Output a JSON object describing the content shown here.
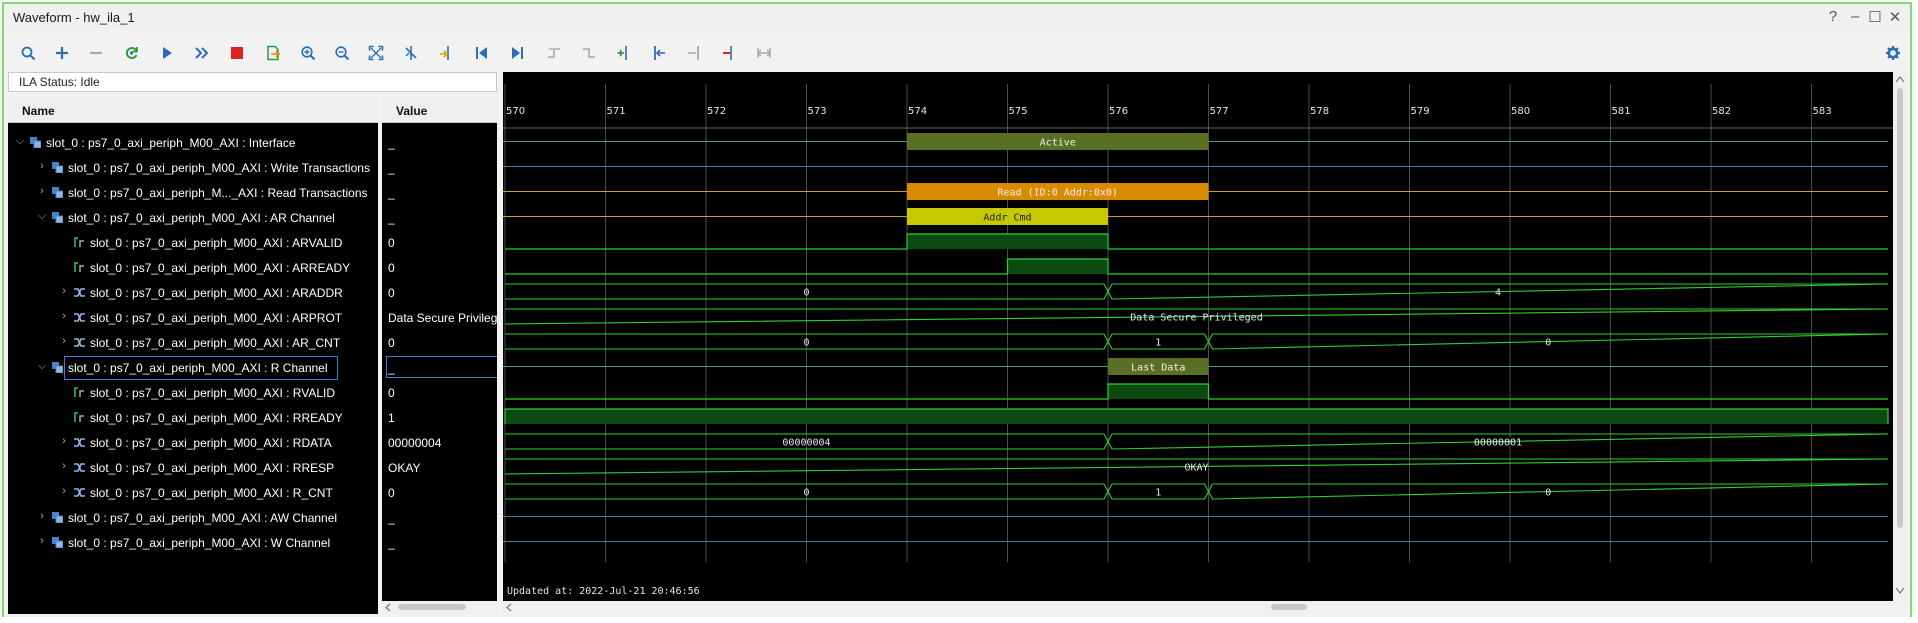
{
  "window": {
    "title": "Waveform - hw_ila_1",
    "help_label": "?",
    "minimize_label": "–",
    "maximize_label": "☐",
    "close_label": "✕"
  },
  "status": {
    "text": "ILA Status:  Idle"
  },
  "columns": {
    "name": "Name",
    "value": "Value"
  },
  "rows": [
    {
      "name": "slot_0 : ps7_0_axi_periph_M00_AXI : Interface",
      "value": "_",
      "level": 0,
      "expander": "open",
      "icon": "interface"
    },
    {
      "name": "slot_0 : ps7_0_axi_periph_M00_AXI : Write Transactions",
      "value": "_",
      "level": 1,
      "expander": "closed",
      "icon": "interface"
    },
    {
      "name": "slot_0 : ps7_0_axi_periph_M..._AXI : Read Transactions",
      "value": "_",
      "level": 1,
      "expander": "closed",
      "icon": "interface"
    },
    {
      "name": "slot_0 : ps7_0_axi_periph_M00_AXI : AR Channel",
      "value": "_",
      "level": 1,
      "expander": "open",
      "icon": "interface"
    },
    {
      "name": "slot_0 : ps7_0_axi_periph_M00_AXI : ARVALID",
      "value": "0",
      "level": 2,
      "expander": "none",
      "icon": "bit"
    },
    {
      "name": "slot_0 : ps7_0_axi_periph_M00_AXI : ARREADY",
      "value": "0",
      "level": 2,
      "expander": "none",
      "icon": "bit"
    },
    {
      "name": "slot_0 : ps7_0_axi_periph_M00_AXI : ARADDR",
      "value": "0",
      "level": 2,
      "expander": "closed",
      "icon": "bus"
    },
    {
      "name": "slot_0 : ps7_0_axi_periph_M00_AXI : ARPROT",
      "value": "Data Secure Privileged",
      "level": 2,
      "expander": "closed",
      "icon": "bus"
    },
    {
      "name": "slot_0 : ps7_0_axi_periph_M00_AXI : AR_CNT",
      "value": "0",
      "level": 2,
      "expander": "closed",
      "icon": "bus"
    },
    {
      "name": "slot_0 : ps7_0_axi_periph_M00_AXI : R Channel",
      "value": "_",
      "level": 1,
      "expander": "open",
      "icon": "interface",
      "selected": true
    },
    {
      "name": "slot_0 : ps7_0_axi_periph_M00_AXI : RVALID",
      "value": "0",
      "level": 2,
      "expander": "none",
      "icon": "bit"
    },
    {
      "name": "slot_0 : ps7_0_axi_periph_M00_AXI : RREADY",
      "value": "1",
      "level": 2,
      "expander": "none",
      "icon": "bit"
    },
    {
      "name": "slot_0 : ps7_0_axi_periph_M00_AXI : RDATA",
      "value": "00000004",
      "level": 2,
      "expander": "closed",
      "icon": "bus"
    },
    {
      "name": "slot_0 : ps7_0_axi_periph_M00_AXI : RRESP",
      "value": "OKAY",
      "level": 2,
      "expander": "closed",
      "icon": "bus"
    },
    {
      "name": "slot_0 : ps7_0_axi_periph_M00_AXI : R_CNT",
      "value": "0",
      "level": 2,
      "expander": "closed",
      "icon": "bus"
    },
    {
      "name": "slot_0 : ps7_0_axi_periph_M00_AXI : AW Channel",
      "value": "_",
      "level": 1,
      "expander": "closed",
      "icon": "interface"
    },
    {
      "name": "slot_0 : ps7_0_axi_periph_M00_AXI : W Channel",
      "value": "_",
      "level": 1,
      "expander": "closed",
      "icon": "interface"
    }
  ],
  "toolbar": [
    {
      "id": "zoom-search",
      "icon": "search-icon"
    },
    {
      "id": "add",
      "icon": "plus-icon"
    },
    {
      "id": "remove",
      "icon": "minus-icon"
    },
    {
      "id": "refresh",
      "icon": "refresh-icon"
    },
    {
      "id": "run-trigger",
      "icon": "play-icon"
    },
    {
      "id": "run-immediate",
      "icon": "double-chevron-icon"
    },
    {
      "id": "stop",
      "icon": "stop-icon"
    },
    {
      "id": "export",
      "icon": "export-icon"
    },
    {
      "id": "zoom-in",
      "icon": "zoom-in-icon"
    },
    {
      "id": "zoom-out",
      "icon": "zoom-out-icon"
    },
    {
      "id": "zoom-fit",
      "icon": "zoom-fit-icon"
    },
    {
      "id": "cursor-off",
      "icon": "cursor-off-icon"
    },
    {
      "id": "marker",
      "icon": "marker-icon"
    },
    {
      "id": "go-first",
      "icon": "go-first-icon"
    },
    {
      "id": "go-last",
      "icon": "go-last-icon"
    },
    {
      "id": "prev-transition",
      "icon": "prev-transition-icon"
    },
    {
      "id": "next-transition",
      "icon": "next-transition-icon"
    },
    {
      "id": "add-marker",
      "icon": "add-marker-icon"
    },
    {
      "id": "prev-marker",
      "icon": "prev-marker-icon"
    },
    {
      "id": "next-marker",
      "icon": "next-marker-icon"
    },
    {
      "id": "swap-cursor",
      "icon": "swap-cursor-icon"
    },
    {
      "id": "floating-ruler",
      "icon": "floating-ruler-icon"
    }
  ],
  "timeline": {
    "start": 570,
    "end": 583,
    "tick_labels": [
      "570",
      "571",
      "572",
      "573",
      "574",
      "575",
      "576",
      "577",
      "578",
      "579",
      "580",
      "581",
      "582",
      "583"
    ]
  },
  "waves": [
    {
      "type": "txn",
      "color": "#5a6e24",
      "blocks": [
        {
          "from": 574,
          "to": 577,
          "label": "Active"
        }
      ]
    },
    {
      "type": "idle"
    },
    {
      "type": "txn",
      "color": "#d98b00",
      "blocks": [
        {
          "from": 574,
          "to": 577,
          "label": "Read (ID:0 Addr:0x0)"
        }
      ]
    },
    {
      "type": "txn",
      "color": "#c8c800",
      "blocks": [
        {
          "from": 574,
          "to": 576,
          "label": "Addr Cmd"
        }
      ]
    },
    {
      "type": "bit",
      "highs": [
        [
          574,
          576
        ]
      ]
    },
    {
      "type": "bit",
      "highs": [
        [
          575,
          576
        ]
      ]
    },
    {
      "type": "bus",
      "segments": [
        {
          "from": 570,
          "to": 576,
          "label": "0"
        },
        {
          "from": 576,
          "to": 584,
          "label": "4"
        }
      ]
    },
    {
      "type": "bus",
      "segments": [
        {
          "from": 570,
          "to": 584,
          "label": "Data Secure Privileged"
        }
      ]
    },
    {
      "type": "bus",
      "segments": [
        {
          "from": 570,
          "to": 576,
          "label": "0"
        },
        {
          "from": 576,
          "to": 577,
          "label": "1"
        },
        {
          "from": 577,
          "to": 584,
          "label": "0"
        }
      ]
    },
    {
      "type": "txn",
      "color": "#5a6e24",
      "blocks": [
        {
          "from": 576,
          "to": 577,
          "label": "Last Data"
        }
      ]
    },
    {
      "type": "bit",
      "highs": [
        [
          576,
          577
        ]
      ]
    },
    {
      "type": "bit",
      "highs": [
        [
          570,
          584
        ]
      ]
    },
    {
      "type": "bus",
      "segments": [
        {
          "from": 570,
          "to": 576,
          "label": "00000004"
        },
        {
          "from": 576,
          "to": 584,
          "label": "00000001"
        }
      ]
    },
    {
      "type": "bus",
      "segments": [
        {
          "from": 570,
          "to": 584,
          "label": "OKAY"
        }
      ]
    },
    {
      "type": "bus",
      "segments": [
        {
          "from": 570,
          "to": 576,
          "label": "0"
        },
        {
          "from": 576,
          "to": 577,
          "label": "1"
        },
        {
          "from": 577,
          "to": 584,
          "label": "0"
        }
      ]
    },
    {
      "type": "idle"
    },
    {
      "type": "idle"
    }
  ],
  "updated": {
    "text": "Updated at: 2022-Jul-21 20:46:56"
  }
}
